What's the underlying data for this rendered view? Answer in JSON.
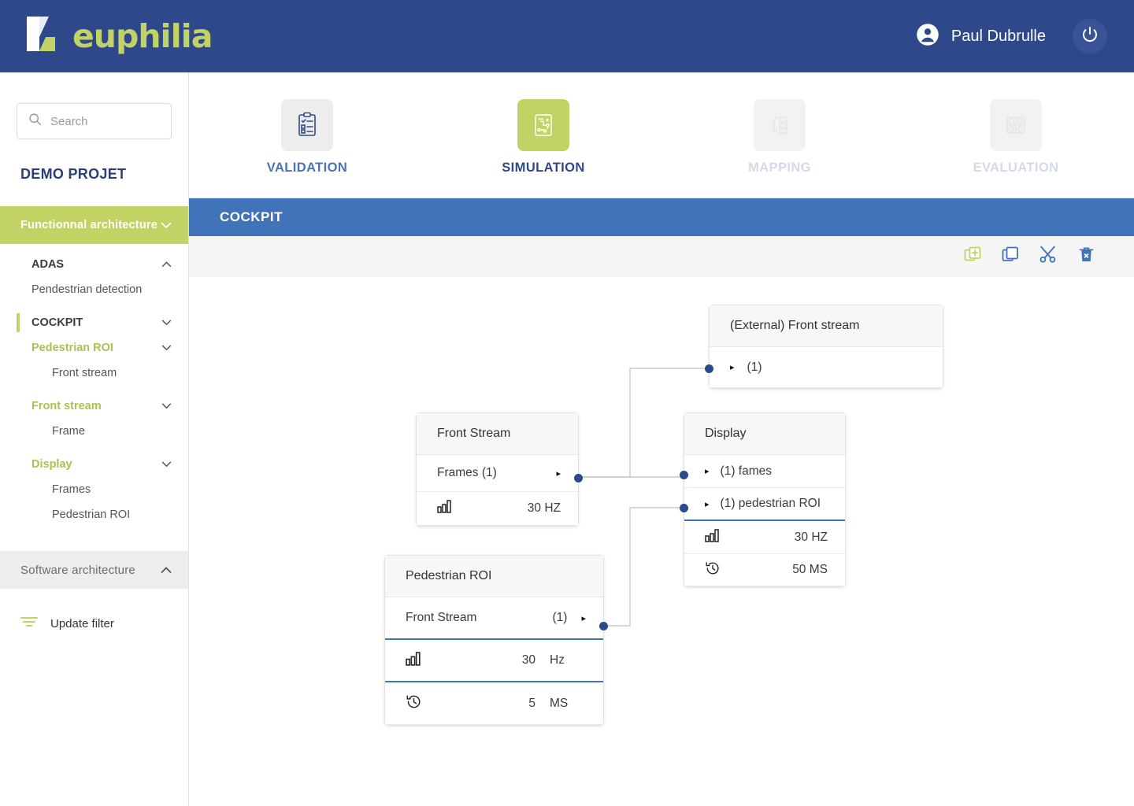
{
  "header": {
    "brand": "euphilia",
    "user_name": "Paul Dubrulle",
    "user_icon": "account-circle-icon",
    "power_icon": "power-icon"
  },
  "sidebar": {
    "search": {
      "placeholder": "Search",
      "value": "",
      "icon": "search-icon"
    },
    "project_title": "DEMO PROJET",
    "functional_section": {
      "label": "Functionnal architecture",
      "chevron": "⌄"
    },
    "tree": [
      {
        "label": "ADAS",
        "type": "group",
        "chevron": "⌃"
      },
      {
        "label": "Pendestrian detection",
        "type": "leaf"
      },
      {
        "label": "COCKPIT",
        "type": "group-marked",
        "chevron": "⌄"
      },
      {
        "label": "Pedestrian ROI",
        "type": "green",
        "chevron": "⌄"
      },
      {
        "label": "Front stream",
        "type": "leaf2"
      },
      {
        "label": "Front stream",
        "type": "green",
        "chevron": "⌄"
      },
      {
        "label": "Frame",
        "type": "leaf2"
      },
      {
        "label": "Display",
        "type": "green",
        "chevron": "⌄"
      },
      {
        "label": "Frames",
        "type": "leaf2"
      },
      {
        "label": "Pedestrian ROI",
        "type": "leaf2"
      }
    ],
    "software_section": {
      "label": "Software architecture",
      "chevron": "⌃"
    },
    "update_filter": {
      "label": "Update filter",
      "icon": "filter-icon"
    }
  },
  "topnav": {
    "tabs": [
      {
        "label": "VALIDATION",
        "icon": "clipboard-check-icon",
        "state": "enabled"
      },
      {
        "label": "SIMULATION",
        "icon": "flowchart-icon",
        "state": "selected"
      },
      {
        "label": "MAPPING",
        "icon": "mapping-arrow-icon",
        "state": "disabled"
      },
      {
        "label": "EVALUATION",
        "icon": "gauge-grid-icon",
        "state": "disabled"
      }
    ]
  },
  "cockpit_bar": {
    "title": "COCKPIT"
  },
  "toolbar": {
    "buttons": [
      {
        "name": "add-button",
        "icon": "add-copy-icon",
        "color": "#c2d264"
      },
      {
        "name": "duplicate-button",
        "icon": "copy-icon",
        "color": "#4173b8"
      },
      {
        "name": "cut-button",
        "icon": "scissors-icon",
        "color": "#4173b8"
      },
      {
        "name": "delete-button",
        "icon": "trash-x-icon",
        "color": "#4173b8"
      }
    ]
  },
  "diagram": {
    "nodes": [
      {
        "id": "external-front-stream",
        "title": "(External) Front stream",
        "rows": [
          {
            "arrow": "▸",
            "label": "(1)"
          }
        ]
      },
      {
        "id": "front-stream",
        "title": "Front Stream",
        "rows": [
          {
            "label": "Frames (1)",
            "arrow": "▸"
          },
          {
            "icon": "bar-chart-icon",
            "value": "30 HZ"
          }
        ]
      },
      {
        "id": "display",
        "title": "Display",
        "rows": [
          {
            "arrow": "▸",
            "label": "(1)  fames"
          },
          {
            "arrow": "▸",
            "label": "(1) pedestrian ROI"
          },
          {
            "icon": "bar-chart-icon",
            "value": "30 HZ"
          },
          {
            "icon": "history-icon",
            "value": "50 MS"
          }
        ]
      },
      {
        "id": "pedestrian-roi",
        "title": "Pedestrian ROI",
        "rows": [
          {
            "label": "Front Stream",
            "value": "(1)",
            "arrow": "▸"
          },
          {
            "icon": "bar-chart-icon",
            "value": "30",
            "unit": "Hz"
          },
          {
            "icon": "history-icon",
            "value": "5",
            "unit": "MS"
          }
        ]
      }
    ]
  },
  "colors": {
    "brand_blue": "#2f4889",
    "accent_green": "#c2d264",
    "bar_blue": "#4173b8",
    "port_blue": "#2b4a8b"
  }
}
